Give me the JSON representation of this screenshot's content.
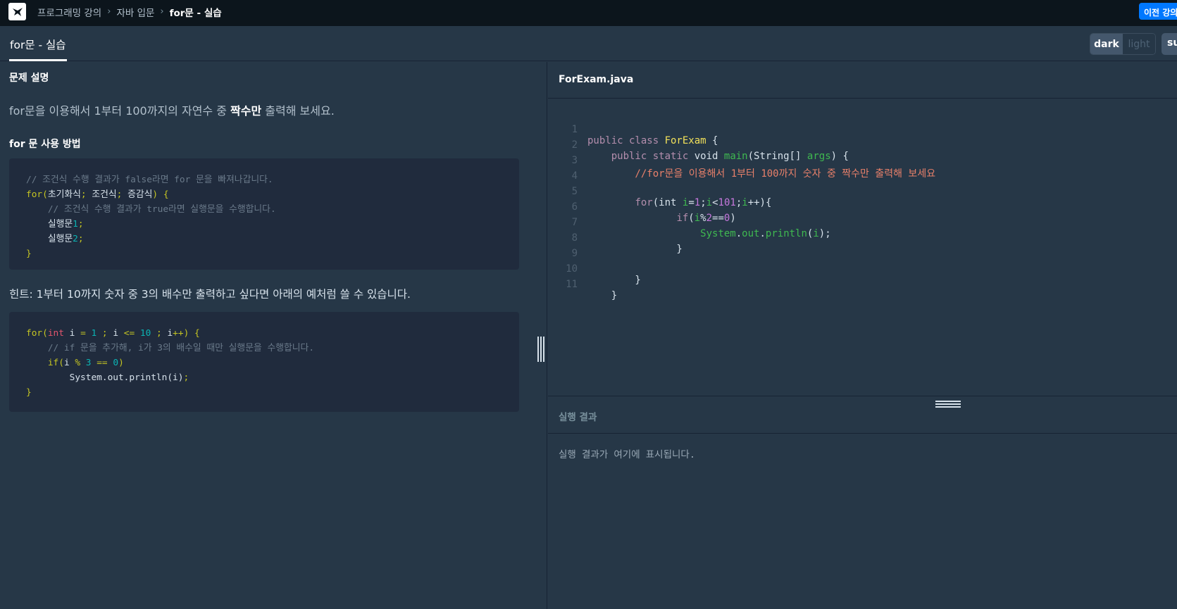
{
  "breadcrumb": {
    "items": [
      "프로그래밍 강의",
      "자바 입문"
    ],
    "current": "for문 - 실습"
  },
  "header": {
    "prev_button": "이전 강의"
  },
  "tabs": {
    "active": "for문 - 실습"
  },
  "theme": {
    "dark": "dark",
    "light": "light",
    "submit": "su"
  },
  "problem": {
    "title": "문제 설명",
    "desc_prefix": "for문을 이용해서 1부터 100까지의 자연수 중 ",
    "desc_bold": "짝수만",
    "desc_suffix": " 출력해 보세요.",
    "usage_title": "for 문 사용 방법",
    "usage_code": [
      "// 조건식 수행 결과가 false라면 for 문을 빠져나갑니다.",
      "for(초기화식; 조건식; 증감식) {",
      "    // 조건식 수행 결과가 true라면 실행문을 수행합니다.",
      "    실행문1;",
      "    실행문2;",
      "}"
    ],
    "hint": "힌트: 1부터 10까지 숫자 중 3의 배수만 출력하고 싶다면 아래의 예처럼 쓸 수 있습니다.",
    "hint_code": [
      "for(int i = 1 ; i <= 10 ; i++) {",
      "    // if 문을 추가해, i가 3의 배수일 때만 실행문을 수행합니다.",
      "    if(i % 3 == 0)",
      "        System.out.println(i);",
      "}"
    ]
  },
  "editor": {
    "file_name": "ForExam.java",
    "line_numbers": [
      "1",
      "2",
      "3",
      "4",
      "5",
      "6",
      "7",
      "8",
      "9",
      "10",
      "11"
    ],
    "lines": [
      "public class ForExam {",
      "    public static void main(String[] args) {",
      "        //for문을 이용해서 1부터 100까지 숫자 중 짝수만 출력해 보세요",
      "",
      "        for(int i=1;i<101;i++){",
      "               if(i%2==0)",
      "                   System.out.println(i);",
      "               }",
      "",
      "        }",
      "    }"
    ]
  },
  "result": {
    "title": "실행 결과",
    "placeholder": "실행 결과가 여기에 표시됩니다."
  },
  "colors": {
    "background": "#263747",
    "topbar": "#0c151c",
    "accent": "#0078ff"
  }
}
